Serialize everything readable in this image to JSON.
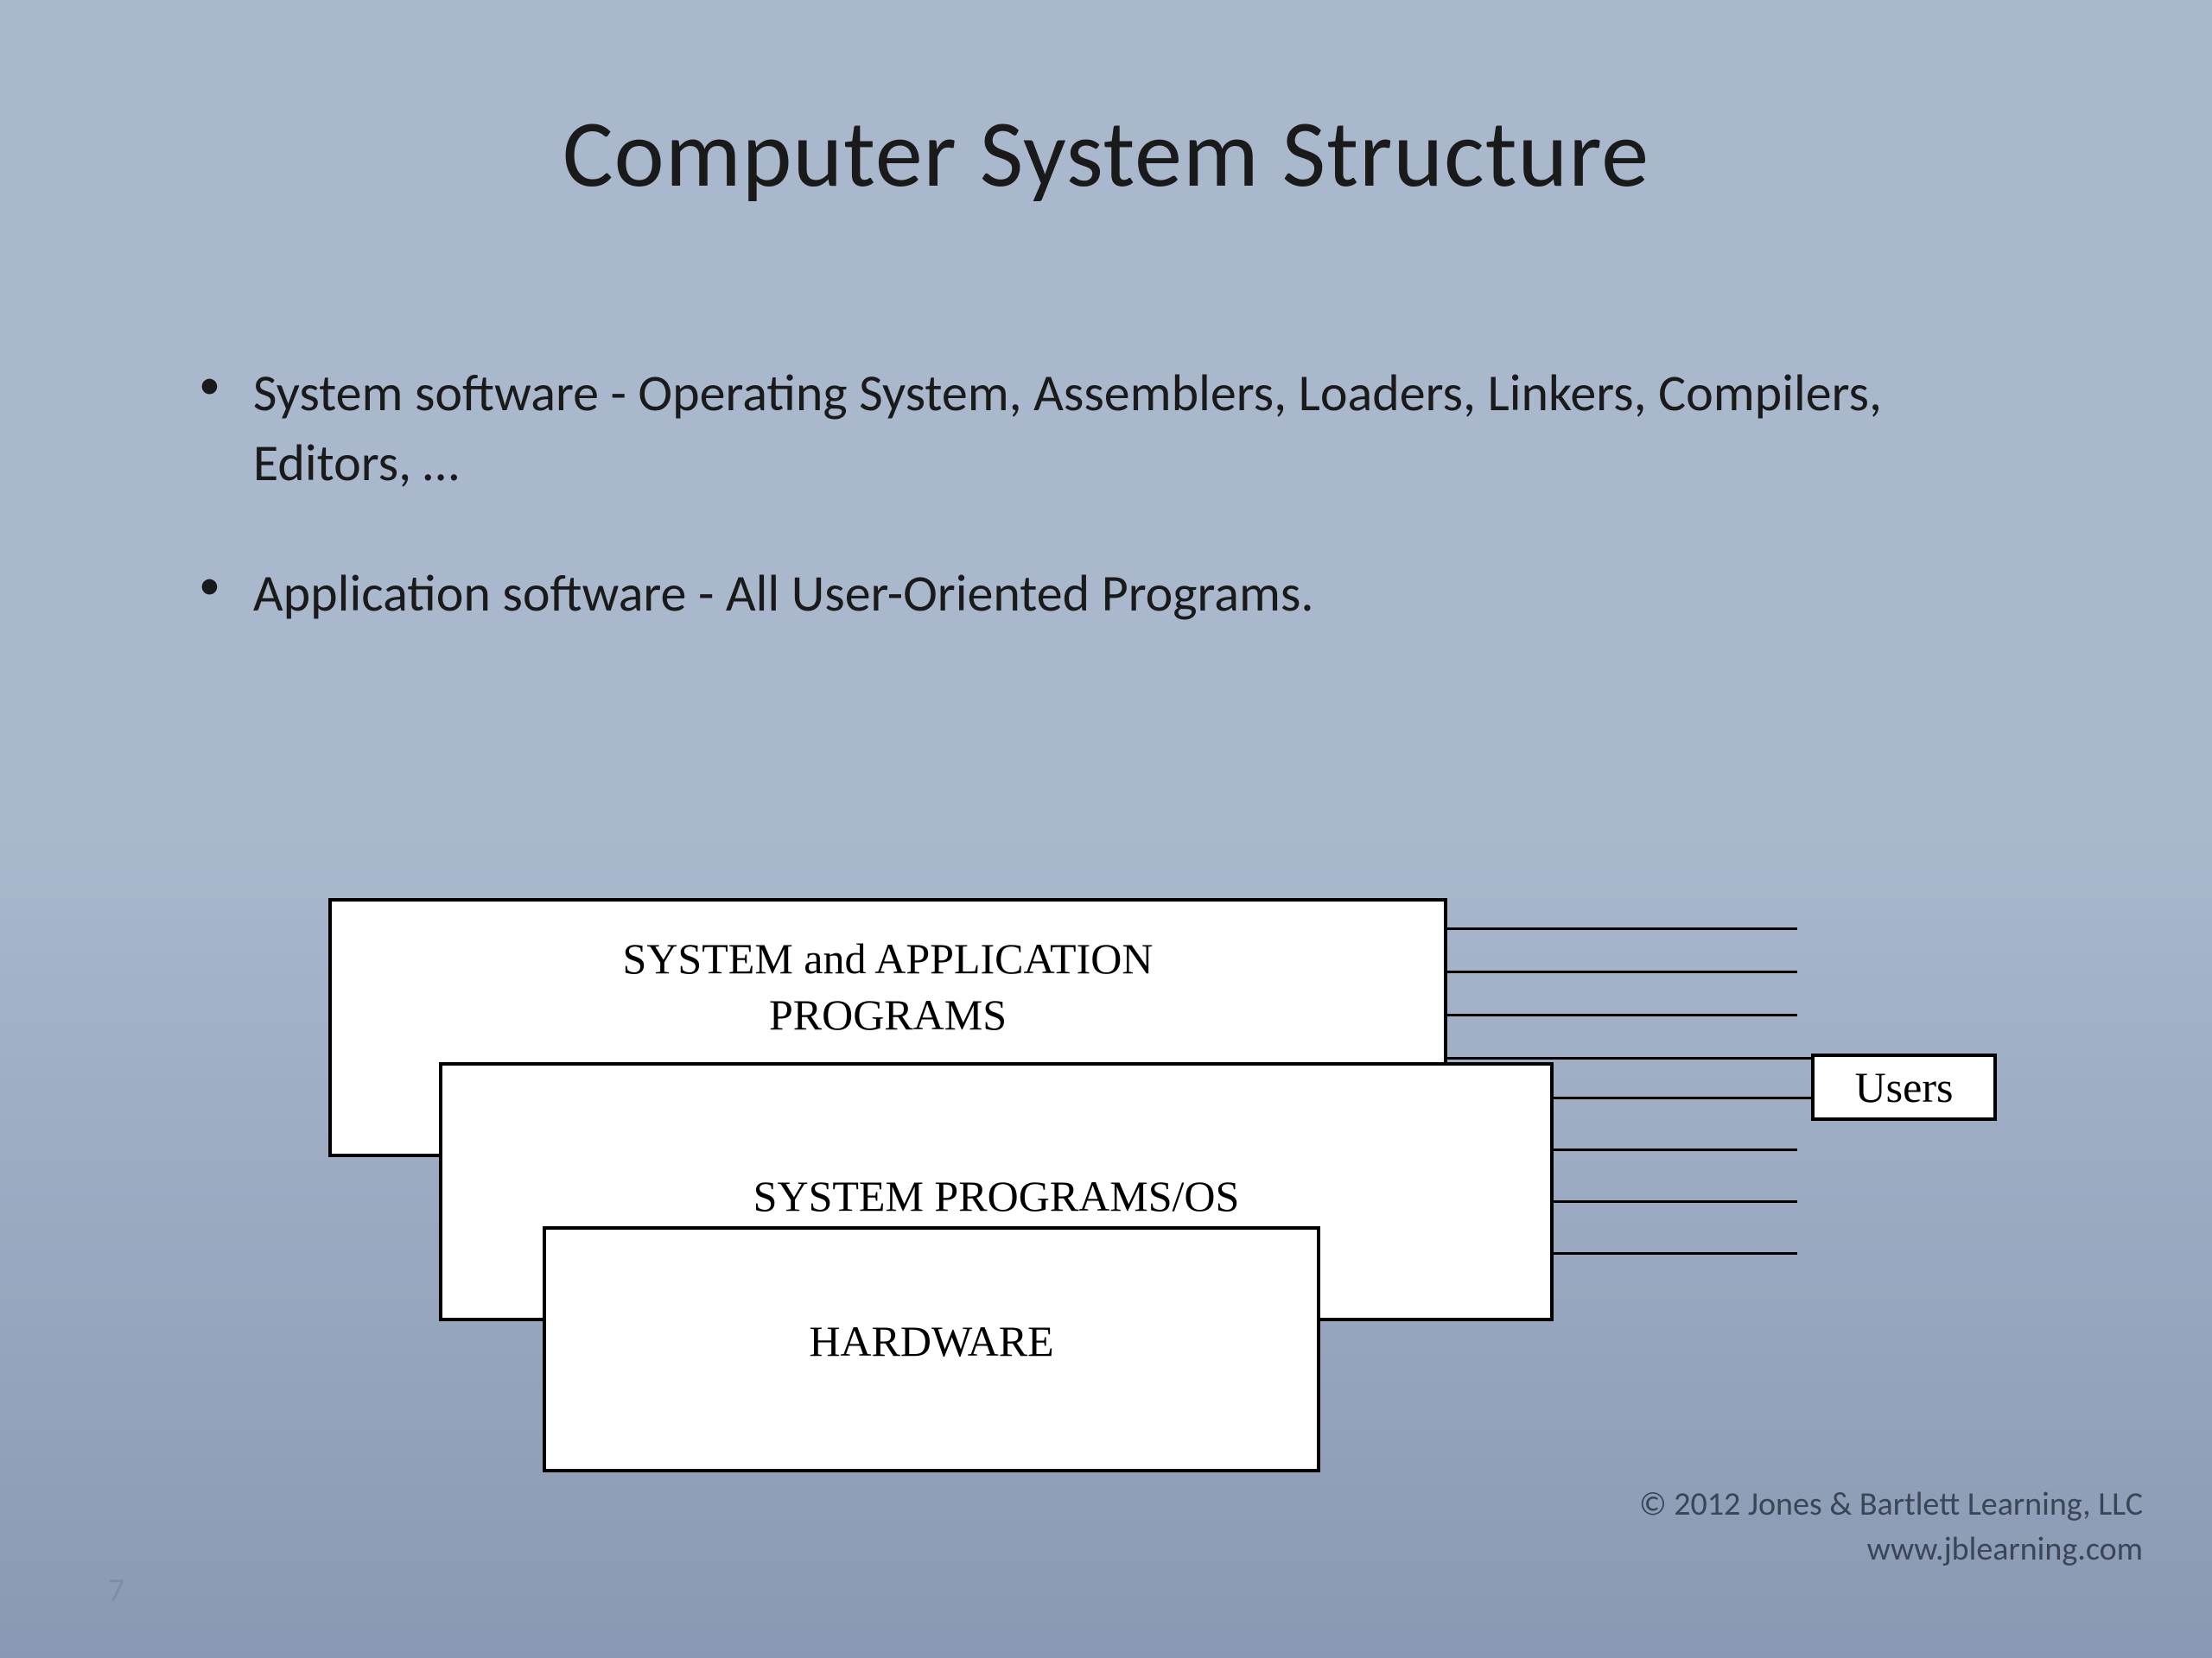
{
  "title": "Computer System Structure",
  "bullets": [
    "System software - Operating System, Assemblers, Loaders, Linkers, Compilers, Editors, …",
    "Application software -  All User-Oriented Programs."
  ],
  "diagram": {
    "layers": [
      "SYSTEM and APPLICATION PROGRAMS",
      "SYSTEM  PROGRAMS/OS",
      "HARDWARE"
    ],
    "side_label": "Users"
  },
  "copyright_line1": "© 2012 Jones & Bartlett Learning, LLC",
  "copyright_line2": "www.jblearning.com",
  "page_number": "7"
}
